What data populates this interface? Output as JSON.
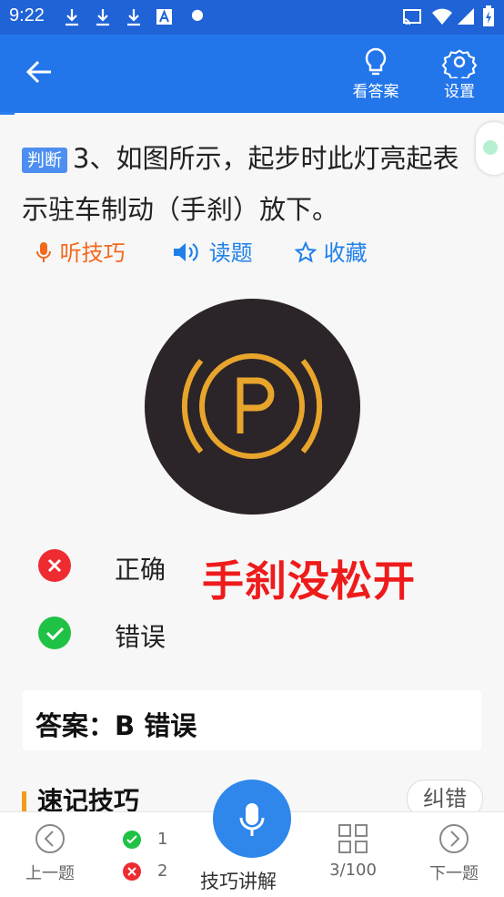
{
  "status_bar": {
    "time": "9:22",
    "icons": [
      "download-icon",
      "download-icon",
      "download-icon",
      "font-icon",
      "dot-icon",
      "cast-icon",
      "wifi-icon",
      "signal-icon",
      "battery-charging-icon"
    ]
  },
  "app_bar": {
    "answer_label": "看答案",
    "settings_label": "设置"
  },
  "question": {
    "type_tag": "判断",
    "text": "3、如图所示，起步时此灯亮起表示驻车制动（手刹）放下。",
    "actions": {
      "listen_tips": "听技巧",
      "read_question": "读题",
      "favorite": "收藏"
    }
  },
  "options": [
    {
      "label": "正确",
      "state": "wrong"
    },
    {
      "label": "错误",
      "state": "correct"
    }
  ],
  "hint": "手刹没松开",
  "answer": "答案：B 错误",
  "memo_section": {
    "title": "速记技巧",
    "report_button": "纠错"
  },
  "bottom_bar": {
    "prev": "上一题",
    "correct_count": "1",
    "wrong_count": "2",
    "explain": "技巧讲解",
    "progress": "3/100",
    "next": "下一题"
  },
  "colors": {
    "primary": "#2376ea",
    "status_bar": "#1f63d6",
    "accent_orange": "#f2691d",
    "correct_green": "#1fc244",
    "wrong_red": "#ef2b32",
    "hint_red": "#ee1b1b"
  }
}
